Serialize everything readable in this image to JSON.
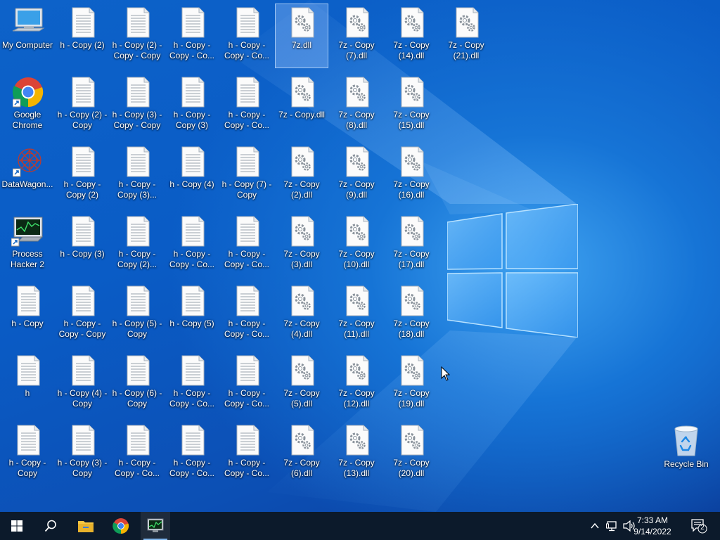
{
  "desktop": {
    "icons": [
      {
        "label": "My Computer",
        "type": "computer"
      },
      {
        "label": "Google Chrome",
        "type": "chrome"
      },
      {
        "label": "DataWagon...",
        "type": "datawagon"
      },
      {
        "label": "Process Hacker 2",
        "type": "processhacker"
      },
      {
        "label": "h - Copy",
        "type": "doc"
      },
      {
        "label": "h",
        "type": "doc"
      },
      {
        "label": "h - Copy - Copy",
        "type": "doc"
      },
      {
        "label": "h - Copy (2)",
        "type": "doc"
      },
      {
        "label": "h - Copy (2) - Copy",
        "type": "doc"
      },
      {
        "label": "h - Copy - Copy (2)",
        "type": "doc"
      },
      {
        "label": "h - Copy (3)",
        "type": "doc"
      },
      {
        "label": "h - Copy - Copy - Copy",
        "type": "doc"
      },
      {
        "label": "h - Copy (4) - Copy",
        "type": "doc"
      },
      {
        "label": "h - Copy (3) - Copy",
        "type": "doc"
      },
      {
        "label": "h - Copy (2) - Copy - Copy",
        "type": "doc"
      },
      {
        "label": "h - Copy (3) - Copy - Copy",
        "type": "doc"
      },
      {
        "label": "h - Copy - Copy (3)...",
        "type": "doc"
      },
      {
        "label": "h - Copy - Copy (2)...",
        "type": "doc"
      },
      {
        "label": "h - Copy (5) - Copy",
        "type": "doc"
      },
      {
        "label": "h - Copy (6) - Copy",
        "type": "doc"
      },
      {
        "label": "h - Copy - Copy - Co...",
        "type": "doc"
      },
      {
        "label": "h - Copy - Copy - Co...",
        "type": "doc"
      },
      {
        "label": "h - Copy - Copy (3)",
        "type": "doc"
      },
      {
        "label": "h - Copy (4)",
        "type": "doc"
      },
      {
        "label": "h - Copy - Copy - Co...",
        "type": "doc"
      },
      {
        "label": "h - Copy (5)",
        "type": "doc"
      },
      {
        "label": "h - Copy - Copy - Co...",
        "type": "doc"
      },
      {
        "label": "h - Copy - Copy - Co...",
        "type": "doc"
      },
      {
        "label": "h - Copy - Copy - Co...",
        "type": "doc"
      },
      {
        "label": "h - Copy - Copy - Co...",
        "type": "doc"
      },
      {
        "label": "h - Copy (7) - Copy",
        "type": "doc"
      },
      {
        "label": "h - Copy - Copy - Co...",
        "type": "doc"
      },
      {
        "label": "h - Copy - Copy - Co...",
        "type": "doc"
      },
      {
        "label": "h - Copy - Copy - Co...",
        "type": "doc"
      },
      {
        "label": "h - Copy - Copy - Co...",
        "type": "doc"
      },
      {
        "label": "7z.dll",
        "type": "dll",
        "selected": true
      },
      {
        "label": "7z - Copy.dll",
        "type": "dll"
      },
      {
        "label": "7z - Copy (2).dll",
        "type": "dll"
      },
      {
        "label": "7z - Copy (3).dll",
        "type": "dll"
      },
      {
        "label": "7z - Copy (4).dll",
        "type": "dll"
      },
      {
        "label": "7z - Copy (5).dll",
        "type": "dll"
      },
      {
        "label": "7z - Copy (6).dll",
        "type": "dll"
      },
      {
        "label": "7z - Copy (7).dll",
        "type": "dll"
      },
      {
        "label": "7z - Copy (8).dll",
        "type": "dll"
      },
      {
        "label": "7z - Copy (9).dll",
        "type": "dll"
      },
      {
        "label": "7z - Copy (10).dll",
        "type": "dll"
      },
      {
        "label": "7z - Copy (11).dll",
        "type": "dll"
      },
      {
        "label": "7z - Copy (12).dll",
        "type": "dll"
      },
      {
        "label": "7z - Copy (13).dll",
        "type": "dll"
      },
      {
        "label": "7z - Copy (14).dll",
        "type": "dll"
      },
      {
        "label": "7z - Copy (15).dll",
        "type": "dll"
      },
      {
        "label": "7z - Copy (16).dll",
        "type": "dll"
      },
      {
        "label": "7z - Copy (17).dll",
        "type": "dll"
      },
      {
        "label": "7z - Copy (18).dll",
        "type": "dll"
      },
      {
        "label": "7z - Copy (19).dll",
        "type": "dll"
      },
      {
        "label": "7z - Copy (20).dll",
        "type": "dll"
      },
      {
        "label": "7z - Copy (21).dll",
        "type": "dll"
      }
    ],
    "recycle_bin": {
      "label": "Recycle Bin"
    }
  },
  "taskbar": {
    "items": [
      {
        "name": "start-button",
        "icon": "windows-logo-icon"
      },
      {
        "name": "search-button",
        "icon": "search-icon"
      },
      {
        "name": "file-explorer",
        "icon": "folder-icon"
      },
      {
        "name": "chrome",
        "icon": "chrome-icon"
      },
      {
        "name": "process-hacker",
        "icon": "process-hacker-icon",
        "active": true
      }
    ],
    "tray": {
      "time": "7:33 AM",
      "date": "9/14/2022",
      "notification_count": "2"
    }
  },
  "colors": {
    "taskbar": "#0c1a2b",
    "accent": "#7eb4ea",
    "desktop": "#0a5cc6"
  }
}
